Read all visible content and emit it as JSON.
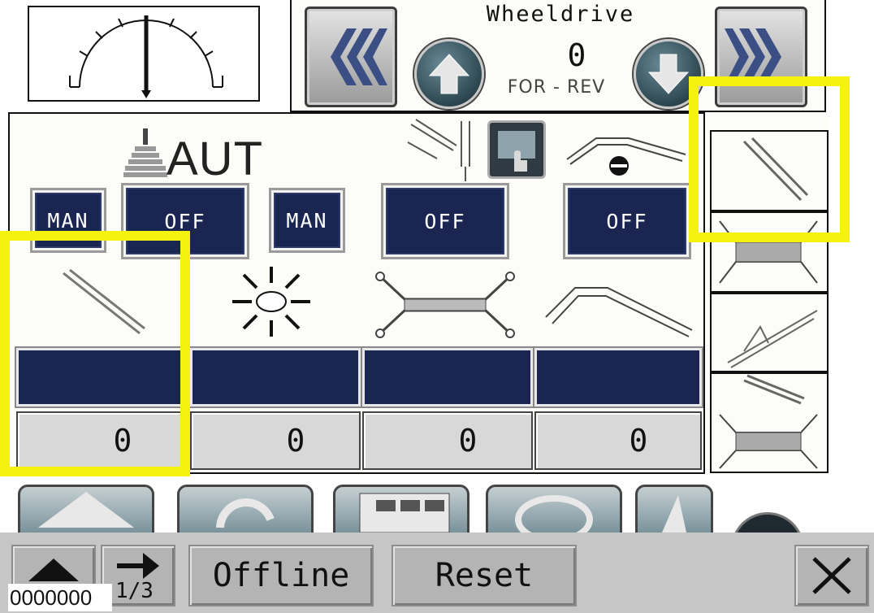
{
  "header": {
    "title": "Wheeldrive",
    "value": "0",
    "for_rev": "FOR - REV"
  },
  "controls": {
    "aut_label": "AUT",
    "buttons": [
      {
        "label": "MAN"
      },
      {
        "label": "OFF"
      },
      {
        "label": "MAN"
      },
      {
        "label": "OFF"
      },
      {
        "label": "OFF"
      }
    ]
  },
  "values": [
    "0",
    "0",
    "0",
    "0"
  ],
  "footer": {
    "offline_label": "Offline",
    "reset_label": "Reset",
    "counter": "0000000",
    "page_indicator": "1/3"
  },
  "icons": {
    "gauge": "gauge-icon",
    "prev": "double-chevron-left-icon",
    "next": "double-chevron-right-icon",
    "up": "arrow-up-icon",
    "down": "arrow-down-icon",
    "close": "close-icon",
    "eject": "eject-icon",
    "arrow_right": "arrow-right-icon"
  },
  "colors": {
    "button_dark": "#1b2552",
    "highlight": "#f6f20f",
    "footer_bg": "#c6c6c6"
  }
}
